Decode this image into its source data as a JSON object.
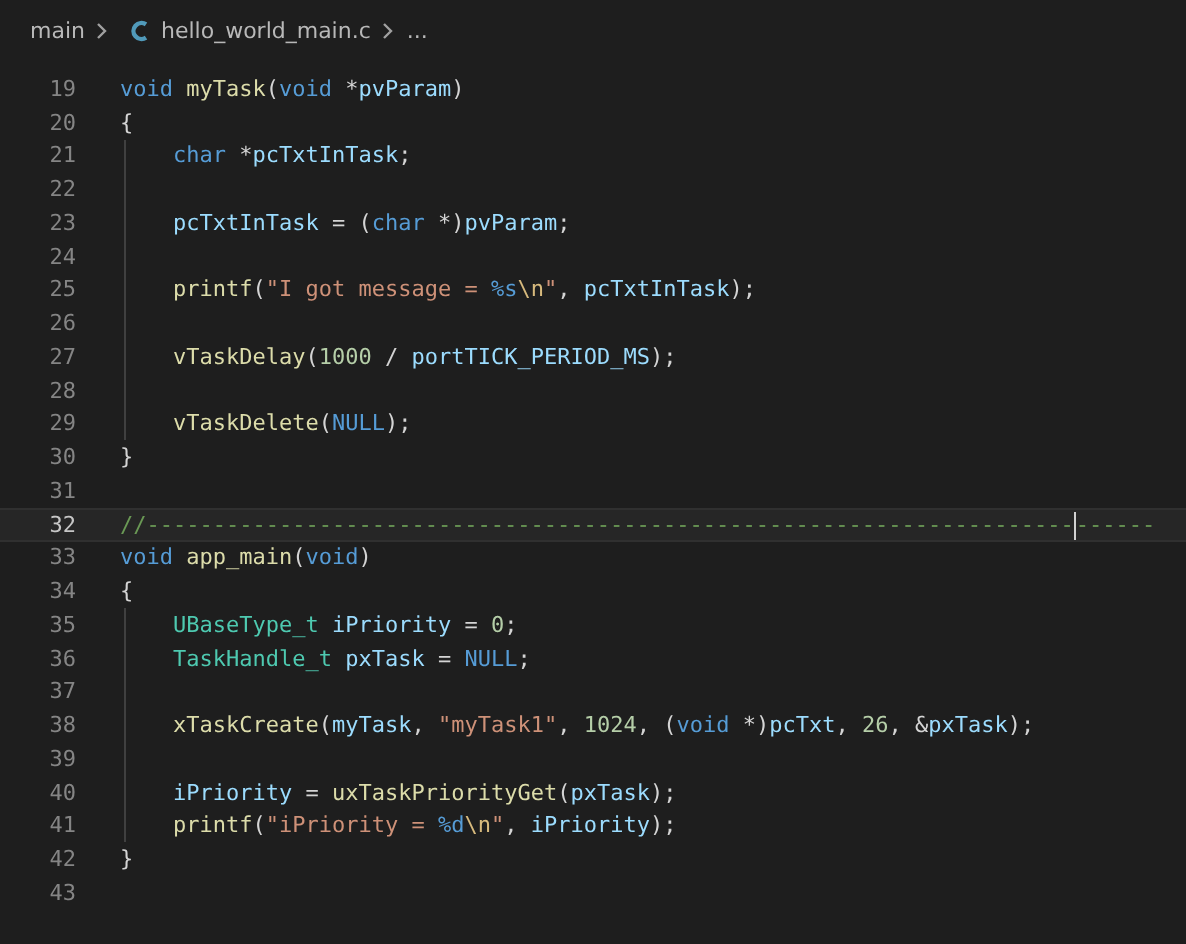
{
  "breadcrumb": {
    "folder": "main",
    "file": "hello_world_main.c",
    "more": "..."
  },
  "lines": [
    {
      "number": "19",
      "indented": false,
      "current": false,
      "tokens": [
        {
          "text": "void",
          "color": "#569cd6"
        },
        {
          "text": " myTask",
          "color": "#dcdcaa"
        },
        {
          "text": "(",
          "color": "#d4d4d4"
        },
        {
          "text": "void",
          "color": "#569cd6"
        },
        {
          "text": " *",
          "color": "#d4d4d4"
        },
        {
          "text": "pvParam",
          "color": "#9cdcfe"
        },
        {
          "text": ")",
          "color": "#d4d4d4"
        }
      ]
    },
    {
      "number": "20",
      "indented": false,
      "current": false,
      "tokens": [
        {
          "text": "{",
          "color": "#d4d4d4"
        }
      ]
    },
    {
      "number": "21",
      "indented": true,
      "current": false,
      "tokens": [
        {
          "text": "char",
          "color": "#569cd6"
        },
        {
          "text": " *",
          "color": "#d4d4d4"
        },
        {
          "text": "pcTxtInTask",
          "color": "#9cdcfe"
        },
        {
          "text": ";",
          "color": "#d4d4d4"
        }
      ]
    },
    {
      "number": "22",
      "indented": true,
      "current": false
    },
    {
      "number": "23",
      "indented": true,
      "current": false,
      "tokens": [
        {
          "text": "pcTxtInTask",
          "color": "#9cdcfe"
        },
        {
          "text": " = (",
          "color": "#d4d4d4"
        },
        {
          "text": "char",
          "color": "#569cd6"
        },
        {
          "text": " *)",
          "color": "#d4d4d4"
        },
        {
          "text": "pvParam",
          "color": "#9cdcfe"
        },
        {
          "text": ";",
          "color": "#d4d4d4"
        }
      ]
    },
    {
      "number": "24",
      "indented": true,
      "current": false
    },
    {
      "number": "25",
      "indented": true,
      "current": false,
      "tokens": [
        {
          "text": "printf",
          "color": "#dcdcaa"
        },
        {
          "text": "(",
          "color": "#d4d4d4"
        },
        {
          "text": "\"I got message = ",
          "color": "#ce9178"
        },
        {
          "text": "%s",
          "color": "#569cd6"
        },
        {
          "text": "\\n",
          "color": "#d7ba7d"
        },
        {
          "text": "\"",
          "color": "#ce9178"
        },
        {
          "text": ", ",
          "color": "#d4d4d4"
        },
        {
          "text": "pcTxtInTask",
          "color": "#9cdcfe"
        },
        {
          "text": ");",
          "color": "#d4d4d4"
        }
      ]
    },
    {
      "number": "26",
      "indented": true,
      "current": false
    },
    {
      "number": "27",
      "indented": true,
      "current": false,
      "tokens": [
        {
          "text": "vTaskDelay",
          "color": "#dcdcaa"
        },
        {
          "text": "(",
          "color": "#d4d4d4"
        },
        {
          "text": "1000",
          "color": "#b5cea8"
        },
        {
          "text": " / ",
          "color": "#d4d4d4"
        },
        {
          "text": "portTICK_PERIOD_MS",
          "color": "#9cdcfe"
        },
        {
          "text": ");",
          "color": "#d4d4d4"
        }
      ]
    },
    {
      "number": "28",
      "indented": true,
      "current": false
    },
    {
      "number": "29",
      "indented": true,
      "current": false,
      "tokens": [
        {
          "text": "vTaskDelete",
          "color": "#dcdcaa"
        },
        {
          "text": "(",
          "color": "#d4d4d4"
        },
        {
          "text": "NULL",
          "color": "#569cd6"
        },
        {
          "text": ");",
          "color": "#d4d4d4"
        }
      ]
    },
    {
      "number": "30",
      "indented": false,
      "current": false,
      "tokens": [
        {
          "text": "}",
          "color": "#d4d4d4"
        }
      ]
    },
    {
      "number": "31",
      "indented": false,
      "current": false
    },
    {
      "number": "32",
      "indented": false,
      "current": true,
      "tokens": [
        {
          "text": "//----------------------------------------------------------------------",
          "color": "#6a9955"
        },
        {
          "text": "------",
          "color": "#6a9955",
          "caret_before": true
        }
      ]
    },
    {
      "number": "33",
      "indented": false,
      "current": false,
      "tokens": [
        {
          "text": "void",
          "color": "#569cd6"
        },
        {
          "text": " app_main",
          "color": "#dcdcaa"
        },
        {
          "text": "(",
          "color": "#d4d4d4"
        },
        {
          "text": "void",
          "color": "#569cd6"
        },
        {
          "text": ")",
          "color": "#d4d4d4"
        }
      ]
    },
    {
      "number": "34",
      "indented": false,
      "current": false,
      "tokens": [
        {
          "text": "{",
          "color": "#d4d4d4"
        }
      ]
    },
    {
      "number": "35",
      "indented": true,
      "current": false,
      "tokens": [
        {
          "text": "UBaseType_t",
          "color": "#4ec9b0"
        },
        {
          "text": " iPriority",
          "color": "#9cdcfe"
        },
        {
          "text": " = ",
          "color": "#d4d4d4"
        },
        {
          "text": "0",
          "color": "#b5cea8"
        },
        {
          "text": ";",
          "color": "#d4d4d4"
        }
      ]
    },
    {
      "number": "36",
      "indented": true,
      "current": false,
      "tokens": [
        {
          "text": "TaskHandle_t",
          "color": "#4ec9b0"
        },
        {
          "text": " pxTask",
          "color": "#9cdcfe"
        },
        {
          "text": " = ",
          "color": "#d4d4d4"
        },
        {
          "text": "NULL",
          "color": "#569cd6"
        },
        {
          "text": ";",
          "color": "#d4d4d4"
        }
      ]
    },
    {
      "number": "37",
      "indented": true,
      "current": false
    },
    {
      "number": "38",
      "indented": true,
      "current": false,
      "tokens": [
        {
          "text": "xTaskCreate",
          "color": "#dcdcaa"
        },
        {
          "text": "(",
          "color": "#d4d4d4"
        },
        {
          "text": "myTask",
          "color": "#9cdcfe"
        },
        {
          "text": ", ",
          "color": "#d4d4d4"
        },
        {
          "text": "\"myTask1\"",
          "color": "#ce9178"
        },
        {
          "text": ", ",
          "color": "#d4d4d4"
        },
        {
          "text": "1024",
          "color": "#b5cea8"
        },
        {
          "text": ", (",
          "color": "#d4d4d4"
        },
        {
          "text": "void",
          "color": "#569cd6"
        },
        {
          "text": " *)",
          "color": "#d4d4d4"
        },
        {
          "text": "pcTxt",
          "color": "#9cdcfe"
        },
        {
          "text": ", ",
          "color": "#d4d4d4"
        },
        {
          "text": "26",
          "color": "#b5cea8"
        },
        {
          "text": ", &",
          "color": "#d4d4d4"
        },
        {
          "text": "pxTask",
          "color": "#9cdcfe"
        },
        {
          "text": ");",
          "color": "#d4d4d4"
        }
      ]
    },
    {
      "number": "39",
      "indented": true,
      "current": false
    },
    {
      "number": "40",
      "indented": true,
      "current": false,
      "tokens": [
        {
          "text": "iPriority",
          "color": "#9cdcfe"
        },
        {
          "text": " = ",
          "color": "#d4d4d4"
        },
        {
          "text": "uxTaskPriorityGet",
          "color": "#dcdcaa"
        },
        {
          "text": "(",
          "color": "#d4d4d4"
        },
        {
          "text": "pxTask",
          "color": "#9cdcfe"
        },
        {
          "text": ");",
          "color": "#d4d4d4"
        }
      ]
    },
    {
      "number": "41",
      "indented": true,
      "current": false,
      "tokens": [
        {
          "text": "printf",
          "color": "#dcdcaa"
        },
        {
          "text": "(",
          "color": "#d4d4d4"
        },
        {
          "text": "\"iPriority = ",
          "color": "#ce9178"
        },
        {
          "text": "%d",
          "color": "#569cd6"
        },
        {
          "text": "\\n",
          "color": "#d7ba7d"
        },
        {
          "text": "\"",
          "color": "#ce9178"
        },
        {
          "text": ", ",
          "color": "#d4d4d4"
        },
        {
          "text": "iPriority",
          "color": "#9cdcfe"
        },
        {
          "text": ");",
          "color": "#d4d4d4"
        }
      ]
    },
    {
      "number": "42",
      "indented": false,
      "current": false,
      "tokens": [
        {
          "text": "}",
          "color": "#d4d4d4"
        }
      ]
    },
    {
      "number": "43",
      "indented": false,
      "current": false
    }
  ]
}
